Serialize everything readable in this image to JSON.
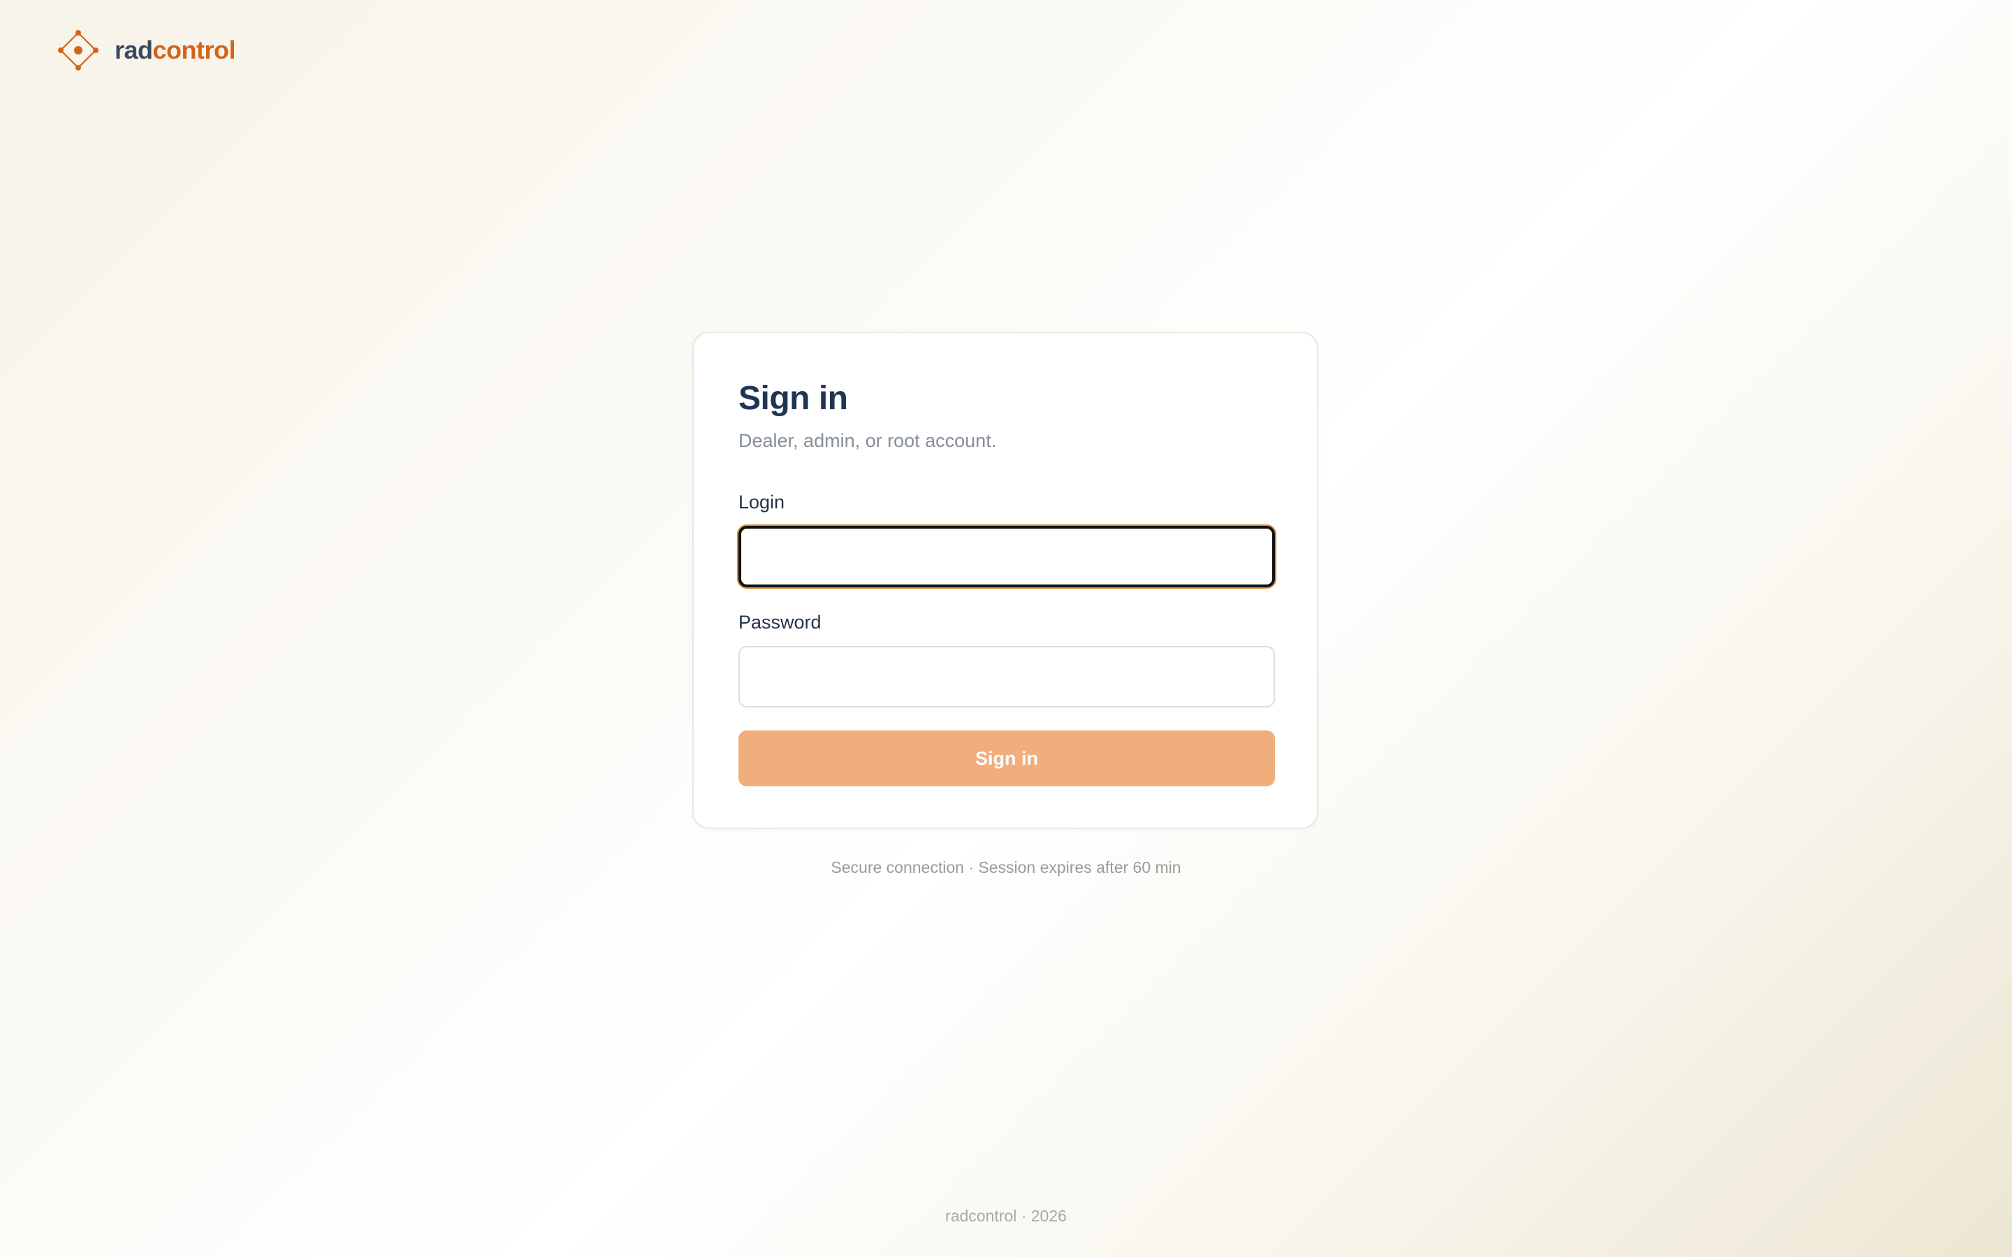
{
  "brand": {
    "name_part1": "rad",
    "name_part2": "control",
    "logo_icon": "diamond-nodes-icon",
    "accent_color": "#d4641a",
    "text_color": "#3c4a5c"
  },
  "login_card": {
    "title": "Sign in",
    "subtitle": "Dealer, admin, or root account.",
    "login_label": "Login",
    "login_value": "",
    "password_label": "Password",
    "password_value": "",
    "submit_label": "Sign in",
    "submit_color": "#f0ae7c"
  },
  "secure_note": "Secure connection · Session expires after 60 min",
  "footer": "radcontrol · 2026"
}
